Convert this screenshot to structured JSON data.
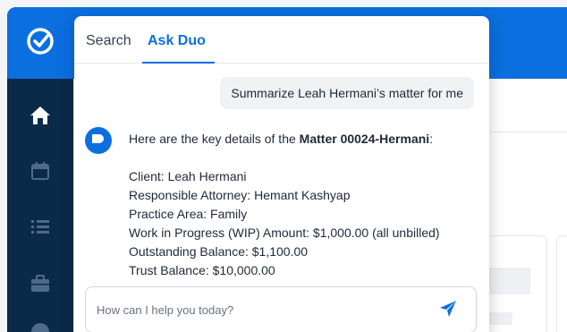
{
  "colors": {
    "brand_blue": "#0b6fe0",
    "sidebar_navy": "#0a2a4a",
    "icon_muted": "#4d6b8a"
  },
  "sidebar": {
    "logo_icon": "checkmark-circle-icon",
    "items": [
      {
        "icon": "home-icon",
        "active": true
      },
      {
        "icon": "calendar-icon",
        "active": false
      },
      {
        "icon": "list-icon",
        "active": false
      },
      {
        "icon": "briefcase-icon",
        "active": false
      }
    ]
  },
  "panel": {
    "tabs": [
      {
        "label": "Search",
        "active": false
      },
      {
        "label": "Ask Duo",
        "active": true
      }
    ],
    "user_message": "Summarize Leah Hermani’s matter for me",
    "assistant": {
      "avatar_icon": "duo-logo-icon",
      "intro_prefix": "Here are the key details of the ",
      "matter_name": "Matter 00024-Hermani",
      "intro_suffix": ":",
      "details": [
        "Client: Leah Hermani",
        "Responsible Attorney: Hemant Kashyap",
        "Practice Area: Family",
        "Work in Progress (WIP) Amount: $1,000.00 (all unbilled)",
        "Outstanding Balance: $1,100.00",
        "Trust Balance: $10,000.00"
      ]
    },
    "composer": {
      "placeholder": "How can I help you today?",
      "value": "",
      "send_icon": "send-icon"
    }
  }
}
